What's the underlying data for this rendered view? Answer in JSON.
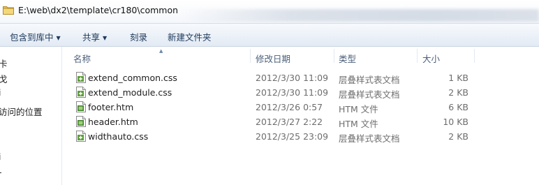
{
  "address": {
    "path": "E:\\web\\dx2\\template\\cr180\\common"
  },
  "toolbar": {
    "items": [
      {
        "label": "包含到库中",
        "has_dropdown": true
      },
      {
        "label": "共享",
        "has_dropdown": true
      },
      {
        "label": "刻录",
        "has_dropdown": false
      },
      {
        "label": "新建文件夹",
        "has_dropdown": false
      }
    ],
    "dropdown_glyph": "▼"
  },
  "nav": {
    "items": [
      "卡",
      "戈",
      "i",
      "访问的位置",
      "i",
      "-"
    ]
  },
  "columns": {
    "name": "名称",
    "date": "修改日期",
    "type": "类型",
    "size": "大小",
    "sort_indicator": "▲"
  },
  "files": [
    {
      "name": "extend_common.css",
      "date": "2012/3/30 11:09",
      "type": "层叠样式表文档",
      "size": "1 KB",
      "icon": "css-file-icon"
    },
    {
      "name": "extend_module.css",
      "date": "2012/3/30 11:09",
      "type": "层叠样式表文档",
      "size": "2 KB",
      "icon": "css-file-icon"
    },
    {
      "name": "footer.htm",
      "date": "2012/3/26 0:57",
      "type": "HTM 文件",
      "size": "6 KB",
      "icon": "htm-file-icon"
    },
    {
      "name": "header.htm",
      "date": "2012/3/27 2:22",
      "type": "HTM 文件",
      "size": "10 KB",
      "icon": "htm-file-icon"
    },
    {
      "name": "widthauto.css",
      "date": "2012/3/25 23:09",
      "type": "层叠样式表文档",
      "size": "2 KB",
      "icon": "css-file-icon"
    }
  ],
  "colors": {
    "toolbar_text": "#1e395b",
    "header_text": "#4c607a",
    "secondary_text": "#6d6d6d",
    "folder": "#e8c25a"
  }
}
